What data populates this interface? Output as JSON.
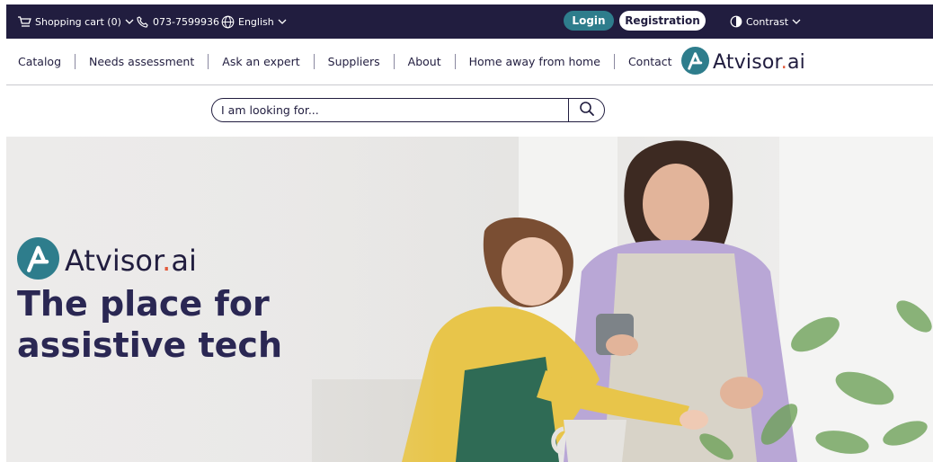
{
  "topbar": {
    "cart_label": "Shopping cart (0)",
    "phone": "073-7599936",
    "language": "English",
    "login": "Login",
    "registration": "Registration",
    "contrast": "Contrast"
  },
  "nav": {
    "items": [
      "Catalog",
      "Needs assessment",
      "Ask an expert",
      "Suppliers",
      "About",
      "Home away from home",
      "Contact"
    ]
  },
  "brand": {
    "name_main": "Atvisor",
    "name_dot": ".",
    "name_suffix": "ai"
  },
  "search": {
    "placeholder": "I am looking for..."
  },
  "hero": {
    "title_line1": "The place for",
    "title_line2": "assistive tech"
  },
  "colors": {
    "navy": "#211d3f",
    "teal": "#2e7d8c",
    "accent": "#e25a3b"
  }
}
